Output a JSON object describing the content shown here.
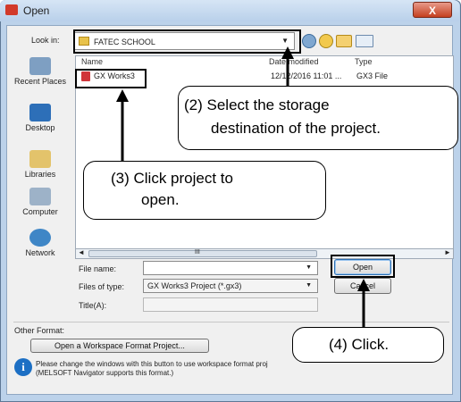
{
  "window": {
    "title": "Open",
    "close_label": "X"
  },
  "look_in": {
    "label": "Look in:",
    "value": "FATEC SCHOOL"
  },
  "places": [
    {
      "label": "Recent Places",
      "icon": "recent-places-icon"
    },
    {
      "label": "Desktop",
      "icon": "desktop-icon"
    },
    {
      "label": "Libraries",
      "icon": "libraries-icon"
    },
    {
      "label": "Computer",
      "icon": "computer-icon"
    },
    {
      "label": "Network",
      "icon": "network-icon"
    }
  ],
  "file_list": {
    "columns": [
      "Name",
      "Date modified",
      "Type"
    ],
    "rows": [
      {
        "name": "GX Works3",
        "date": "12/12/2016 11:01 ...",
        "type": "GX3 File"
      }
    ]
  },
  "scroll_mark": "III",
  "fields": {
    "file_name_label": "File name:",
    "file_name_value": "",
    "file_type_label": "Files of type:",
    "file_type_value": "GX Works3 Project (*.gx3)",
    "title_label": "Title(A):",
    "title_value": ""
  },
  "buttons": {
    "open": "Open",
    "cancel": "Cancel"
  },
  "other_format": {
    "label": "Other Format:",
    "button": "Open a Workspace Format Project...",
    "info": "Please change the windows with this button to use workspace format proj",
    "info2": "(MELSOFT Navigator supports this format.)"
  },
  "callouts": {
    "c2_line1": "(2) Select the storage",
    "c2_line2": "destination of the project.",
    "c3_line1": "(3) Click project to",
    "c3_line2": "open.",
    "c4": "(4) Click."
  },
  "colors": {
    "accent": "#1c6fc4",
    "window_frame": "#bcd2ea"
  }
}
